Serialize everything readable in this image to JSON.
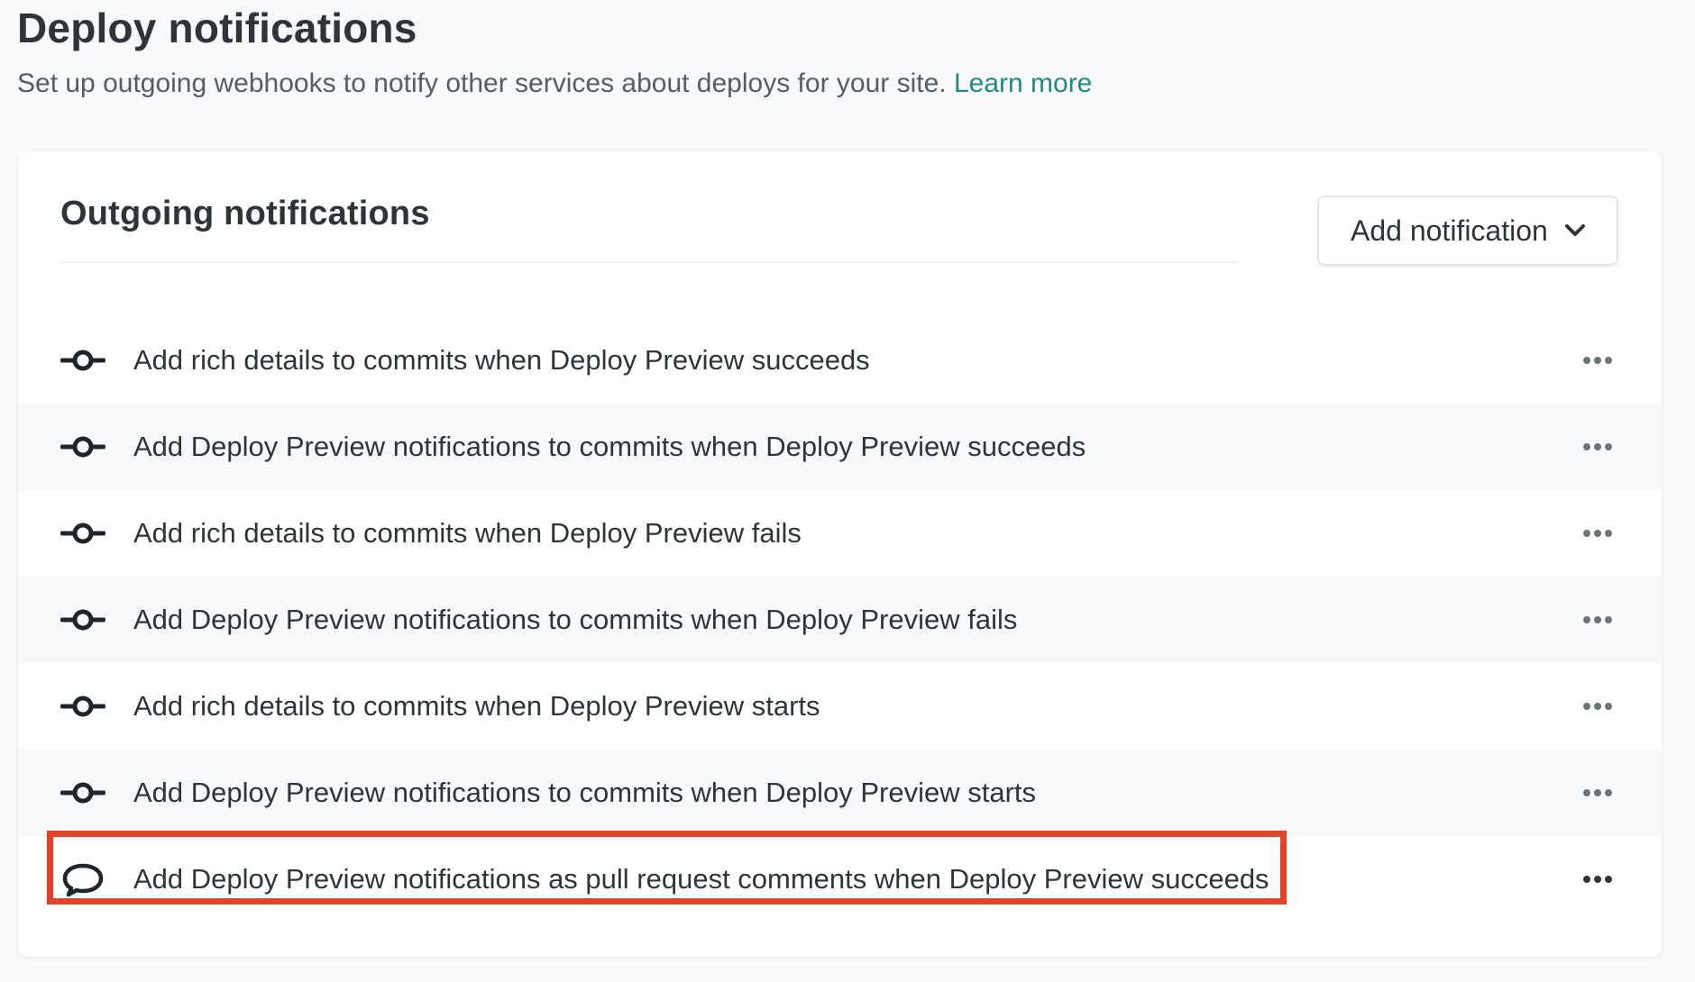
{
  "header": {
    "title": "Deploy notifications",
    "subtitle": "Set up outgoing webhooks to notify other services about deploys for your site.",
    "learn_more": "Learn more"
  },
  "card": {
    "title": "Outgoing notifications",
    "add_button_label": "Add notification"
  },
  "notifications": [
    {
      "label": "Add rich details to commits when Deploy Preview succeeds",
      "icon": "commit-icon"
    },
    {
      "label": "Add Deploy Preview notifications to commits when Deploy Preview succeeds",
      "icon": "commit-icon"
    },
    {
      "label": "Add rich details to commits when Deploy Preview fails",
      "icon": "commit-icon"
    },
    {
      "label": "Add Deploy Preview notifications to commits when Deploy Preview fails",
      "icon": "commit-icon"
    },
    {
      "label": "Add rich details to commits when Deploy Preview starts",
      "icon": "commit-icon"
    },
    {
      "label": "Add Deploy Preview notifications to commits when Deploy Preview starts",
      "icon": "commit-icon"
    },
    {
      "label": "Add Deploy Preview notifications as pull request comments when Deploy Preview succeeds",
      "icon": "comment-icon"
    }
  ],
  "colors": {
    "link": "#25887c",
    "highlight": "#e8412a",
    "text": "#2e3538"
  }
}
